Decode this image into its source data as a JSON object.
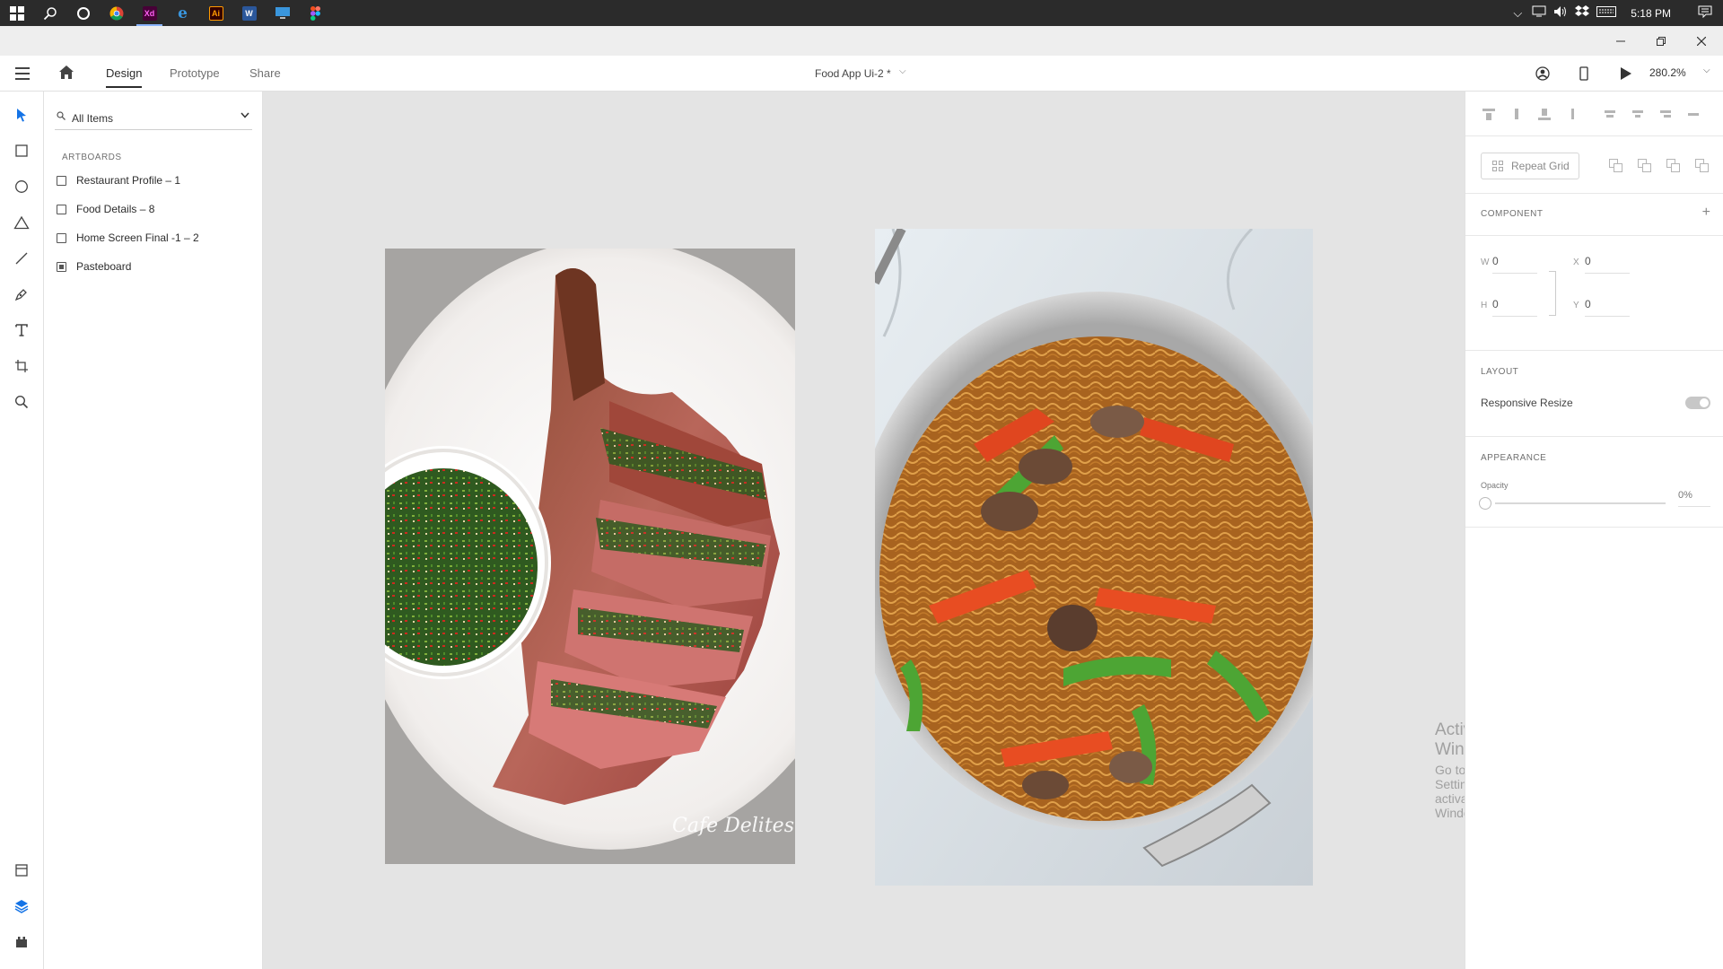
{
  "taskbar": {
    "apps": [
      {
        "name": "windows-start",
        "glyph": "⊞",
        "color": "#ffffff"
      },
      {
        "name": "search",
        "glyph": "⚲",
        "color": "#ffffff"
      },
      {
        "name": "cortana",
        "glyph": "○",
        "color": "#ffffff"
      },
      {
        "name": "chrome",
        "glyph": "",
        "color": "#dd4b39"
      },
      {
        "name": "adobe-xd",
        "glyph": "Xd",
        "color": "#470137"
      },
      {
        "name": "edge",
        "glyph": "e",
        "color": "#0078d7"
      },
      {
        "name": "illustrator",
        "glyph": "Ai",
        "color": "#330000"
      },
      {
        "name": "word",
        "glyph": "W",
        "color": "#2b579a"
      },
      {
        "name": "desktop",
        "glyph": "",
        "color": "#3a96dd"
      },
      {
        "name": "figma",
        "glyph": "",
        "color": "#f24e1e"
      }
    ],
    "clock": "5:18 PM"
  },
  "header": {
    "tabs": [
      "Design",
      "Prototype",
      "Share"
    ],
    "active_tab": "Design",
    "document_title": "Food App Ui-2 *",
    "zoom": "280.2%"
  },
  "layers": {
    "search_placeholder": "All Items",
    "section_label": "ARTBOARDS",
    "items": [
      "Restaurant Profile – 1",
      "Food Details – 8",
      "Home Screen  Final -1 – 2",
      "Pasteboard"
    ]
  },
  "canvas": {
    "watermark_line1": "Activate Windows",
    "watermark_line2": "Go to Settings to activate Windows.",
    "photo_signature": "Cafe Delites"
  },
  "inspector": {
    "repeat_grid_label": "Repeat Grid",
    "component_label": "COMPONENT",
    "w_label": "W",
    "w_value": "0",
    "x_label": "X",
    "x_value": "0",
    "h_label": "H",
    "h_value": "0",
    "y_label": "Y",
    "y_value": "0",
    "layout_label": "LAYOUT",
    "responsive_resize_label": "Responsive Resize",
    "appearance_label": "APPEARANCE",
    "opacity_label": "Opacity",
    "opacity_value": "0%"
  },
  "colors": {
    "accent": "#1473e6",
    "canvas": "#e4e4e4"
  }
}
